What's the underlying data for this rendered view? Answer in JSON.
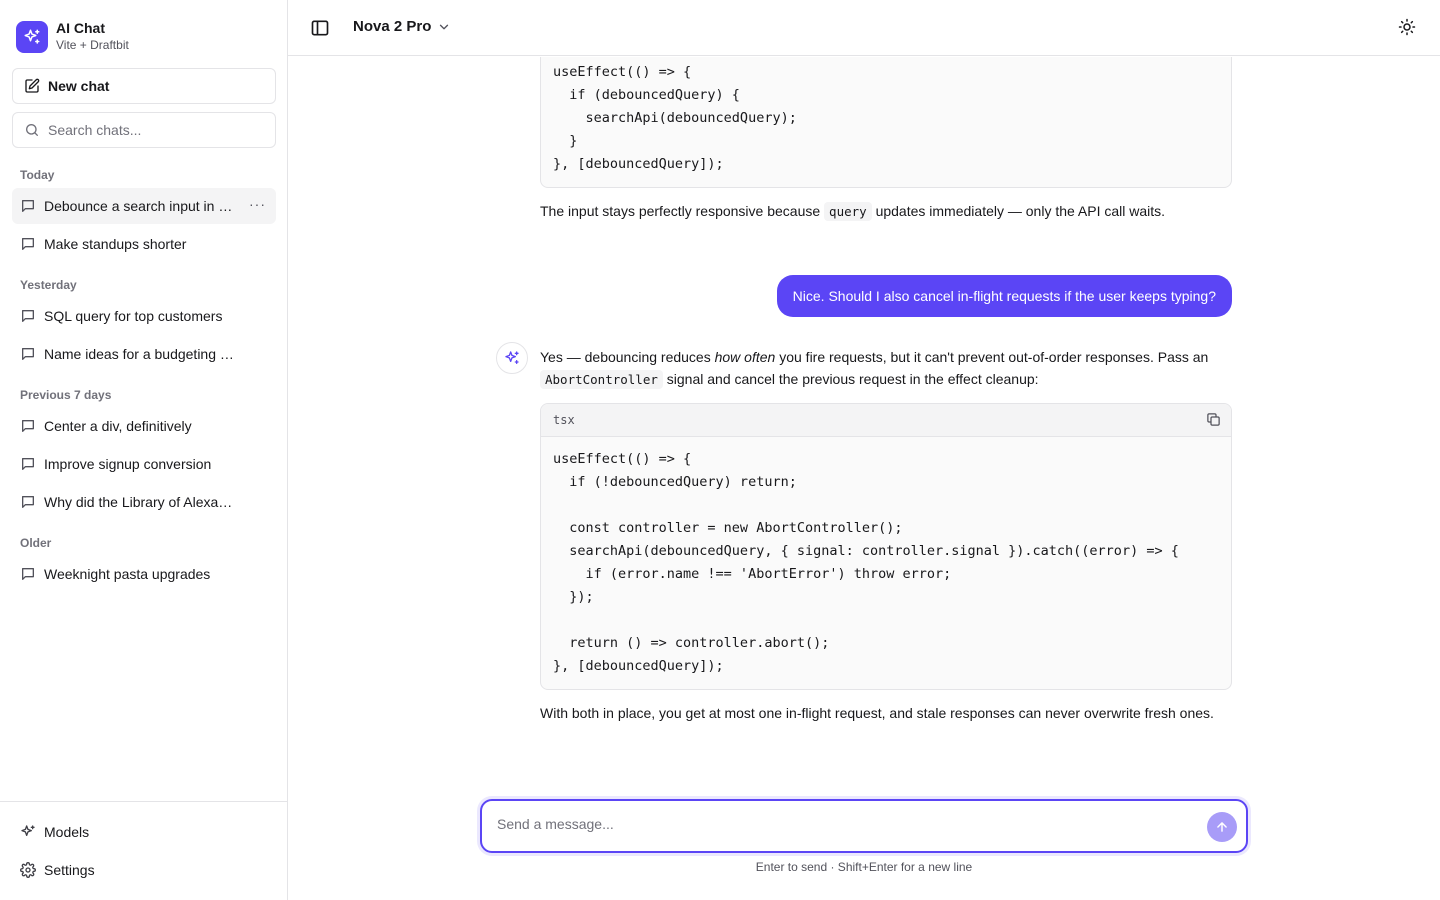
{
  "app": {
    "title": "AI Chat",
    "subtitle": "Vite + Draftbit"
  },
  "sidebar": {
    "new_chat_label": "New chat",
    "search_placeholder": "Search chats...",
    "sections": [
      {
        "label": "Today",
        "items": [
          "Debounce a search input in …",
          "Make standups shorter"
        ]
      },
      {
        "label": "Yesterday",
        "items": [
          "SQL query for top customers",
          "Name ideas for a budgeting …"
        ]
      },
      {
        "label": "Previous 7 days",
        "items": [
          "Center a div, definitively",
          "Improve signup conversion",
          "Why did the Library of Alexa…"
        ]
      },
      {
        "label": "Older",
        "items": [
          "Weeknight pasta upgrades"
        ]
      }
    ],
    "active_item_more": "···",
    "footer": {
      "models_label": "Models",
      "settings_label": "Settings"
    }
  },
  "header": {
    "model_name": "Nova 2 Pro"
  },
  "conversation": {
    "code1": "useEffect(() => {\n  if (debouncedQuery) {\n    searchApi(debouncedQuery);\n  }\n}, [debouncedQuery]);",
    "para1": {
      "before": "The input stays perfectly responsive because ",
      "code": "query",
      "after": " updates immediately — only the API call waits."
    },
    "user_message": "Nice. Should I also cancel in-flight requests if the user keeps typing?",
    "para2": {
      "t1": "Yes — debouncing reduces ",
      "em": "how often",
      "t2": " you fire requests, but it can't prevent out-of-order responses. Pass an ",
      "code": "AbortController",
      "t3": " signal and cancel the previous request in the effect cleanup:"
    },
    "code2_lang": "tsx",
    "code2": "useEffect(() => {\n  if (!debouncedQuery) return;\n\n  const controller = new AbortController();\n  searchApi(debouncedQuery, { signal: controller.signal }).catch((error) => {\n    if (error.name !== 'AbortError') throw error;\n  });\n\n  return () => controller.abort();\n}, [debouncedQuery]);",
    "para3": "With both in place, you get at most one in-flight request, and stale responses can never overwrite fresh ones."
  },
  "composer": {
    "placeholder": "Send a message...",
    "hint": "Enter to send · Shift+Enter for a new line"
  },
  "colors": {
    "accent": "#5b45f5",
    "send_disabled": "#a89cf8",
    "border": "#e4e4e7",
    "muted": "#71717a"
  },
  "icons": [
    "sparkles-icon",
    "edit-icon",
    "search-icon",
    "message-icon",
    "more-icon",
    "settings-icon",
    "sidebar-toggle-icon",
    "chevron-down-icon",
    "sun-icon",
    "copy-icon",
    "arrow-up-icon"
  ]
}
